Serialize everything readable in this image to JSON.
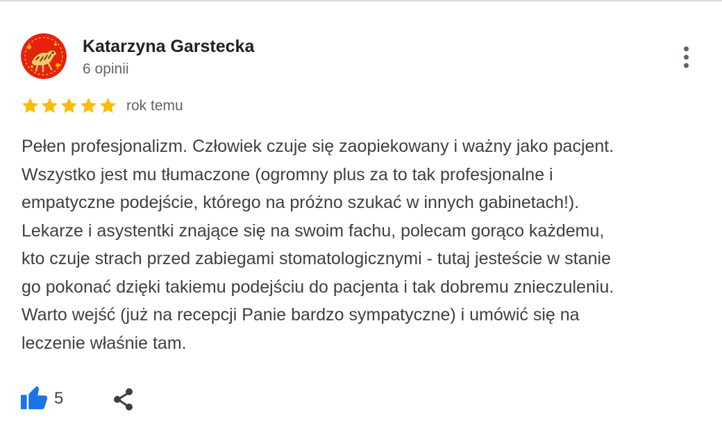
{
  "review": {
    "author": "Katarzyna Garstecka",
    "review_count": "6 opinii",
    "rating": 5,
    "time_ago": "rok temu",
    "text_lines": [
      "Pełen profesjonalizm. Człowiek czuje się zaopiekowany i ważny jako pacjent.",
      "Wszystko jest mu tłumaczone (ogromny plus za to tak profesjonalne i",
      "empatyczne podejście, którego na próżno szukać w innych gabinetach!).",
      "Lekarze i asystentki znające się na swoim fachu, polecam gorąco każdemu,",
      "kto czuje strach przed zabiegami stomatologicznymi - tutaj jesteście w stanie",
      "go pokonać dzięki takiemu podejściu do pacjenta i tak dobremu znieczuleniu.",
      "Warto wejść (już na recepcji Panie bardzo sympatyczne) i umówić się na",
      "leczenie właśnie tam."
    ],
    "likes": "5"
  },
  "icons": {
    "avatar": "avatar-image",
    "menu": "more-vert-icon",
    "star": "star-icon",
    "like": "thumbs-up-icon",
    "share": "share-icon"
  },
  "colors": {
    "star": "#fbbc04",
    "like": "#1a73e8",
    "muted": "#5f6368",
    "text": "#3c4043",
    "avatar_bg": "#e8200f"
  }
}
